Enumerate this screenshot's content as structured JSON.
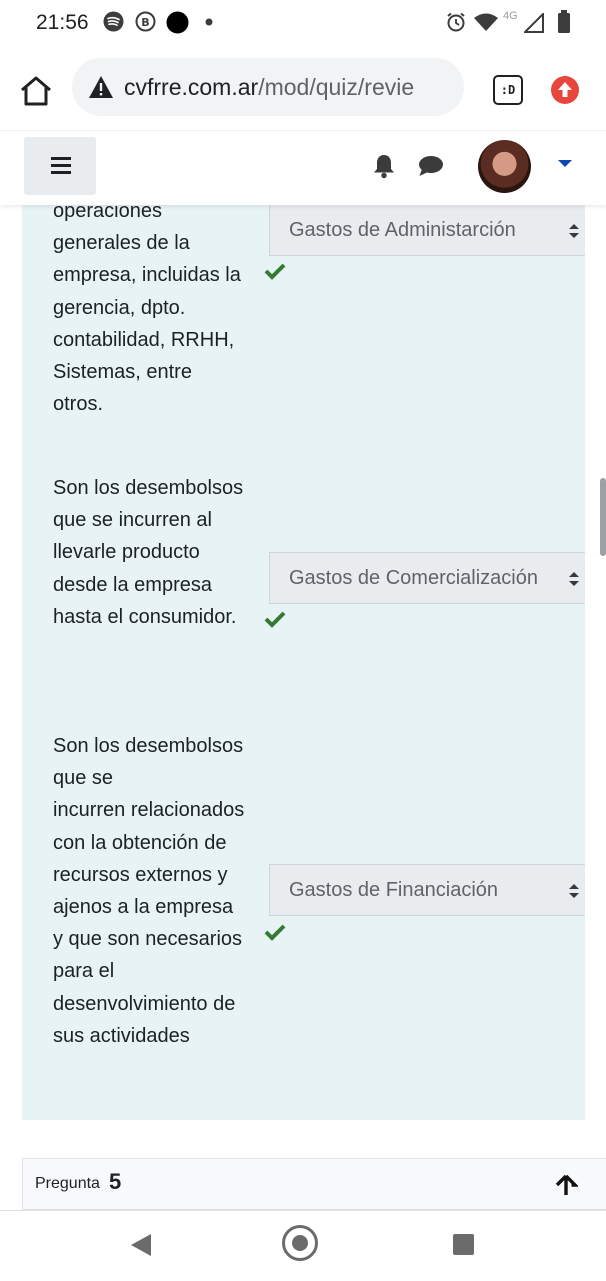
{
  "status_bar": {
    "time": "21:56",
    "network_label": "4G"
  },
  "browser": {
    "url_host": "cvfrre.com.ar",
    "url_path": "/mod/quiz/revie",
    "tabs_label": ":D"
  },
  "questions": [
    {
      "text": "operaciones generales de la empresa, incluidas la gerencia, dpto. contabilidad, RRHH, Sistemas, entre otros.",
      "lines": [
        "operaciones",
        "generales de la",
        "empresa, incluidas la",
        "gerencia, dpto.",
        "contabilidad, RRHH,",
        "Sistemas, entre",
        "otros."
      ],
      "answer": "Gastos de Administarción"
    },
    {
      "text": "Son los desembolsos que se incurren al llevarle producto desde la empresa hasta el consumidor.",
      "lines": [
        "Son los desembolsos",
        "que  se incurren al",
        "llevarle producto",
        "desde la empresa",
        "hasta el consumidor."
      ],
      "answer": "Gastos de Comercialización"
    },
    {
      "text": "Son los desembolsos que se incurren relacionados con la obtención de recursos externos y ajenos a la empresa y que son necesarios para el desenvolvimiento de sus actividades",
      "lines": [
        "Son los desembolsos",
        "que  se",
        "incurren relacionados",
        "con la obtención de",
        "recursos externos y",
        "ajenos a la empresa",
        "y que son necesarios",
        "para el",
        "desenvolvimiento de",
        "sus actividades"
      ],
      "answer": "Gastos de Financiación"
    }
  ],
  "question_nav": {
    "label": "Pregunta",
    "number": "5"
  },
  "colors": {
    "panel_bg": "#e7f3f5",
    "check_green": "#357a32",
    "warning_red": "#e8453c",
    "caret_blue": "#0f47ad"
  },
  "icons": [
    "home-icon",
    "warning-icon",
    "tabs-icon",
    "update-icon",
    "menu-icon",
    "bell-icon",
    "chat-icon",
    "check-icon",
    "up-arrow-icon",
    "back-icon"
  ]
}
